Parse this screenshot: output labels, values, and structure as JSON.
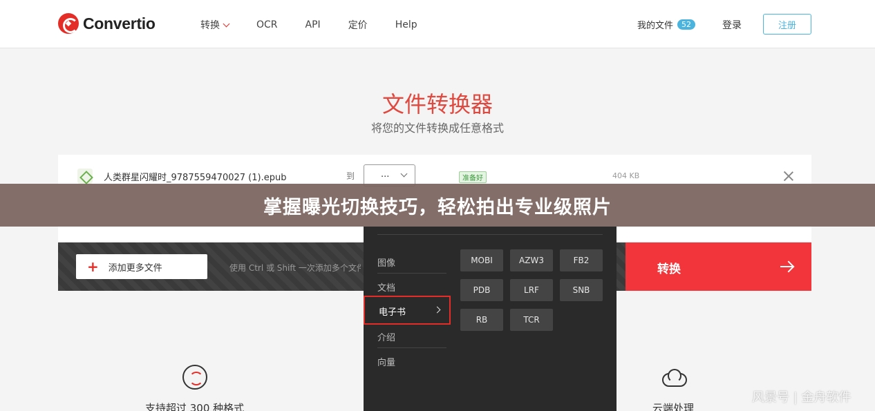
{
  "brand": {
    "name": "Convertio"
  },
  "nav": {
    "items": [
      "转换",
      "OCR",
      "API",
      "定价",
      "Help"
    ],
    "my_files": "我的文件",
    "my_files_count": "52",
    "login": "登录",
    "signup": "注册"
  },
  "hero": {
    "title": "文件转换器",
    "subtitle": "将您的文件转换成任意格式"
  },
  "file": {
    "name": "人类群星闪耀时_9787559470027 (1).epub",
    "to_label": "到",
    "format_value": "...",
    "status": "准备好",
    "size": "404 KB"
  },
  "banner": {
    "text": "掌握曝光切换技巧，轻松拍出专业级照片"
  },
  "actions": {
    "add_files": "添加更多文件",
    "hint": "使用 Ctrl 或 Shift 一次添加多个文件",
    "convert": "转换"
  },
  "dropdown": {
    "categories": [
      "图像",
      "文档",
      "电子书",
      "介绍",
      "向量"
    ],
    "active_category": "电子书",
    "formats": [
      "MOBI",
      "AZW3",
      "FB2",
      "PDB",
      "LRF",
      "SNB",
      "RB",
      "TCR"
    ]
  },
  "features": {
    "left": "支持超过 300 种格式",
    "right": "云端处理"
  },
  "watermark": "风景号 | 金舟软件",
  "colors": {
    "brand_red": "#e52d27",
    "accent_blue": "#4bb4de",
    "convert_red": "#f2353a"
  }
}
